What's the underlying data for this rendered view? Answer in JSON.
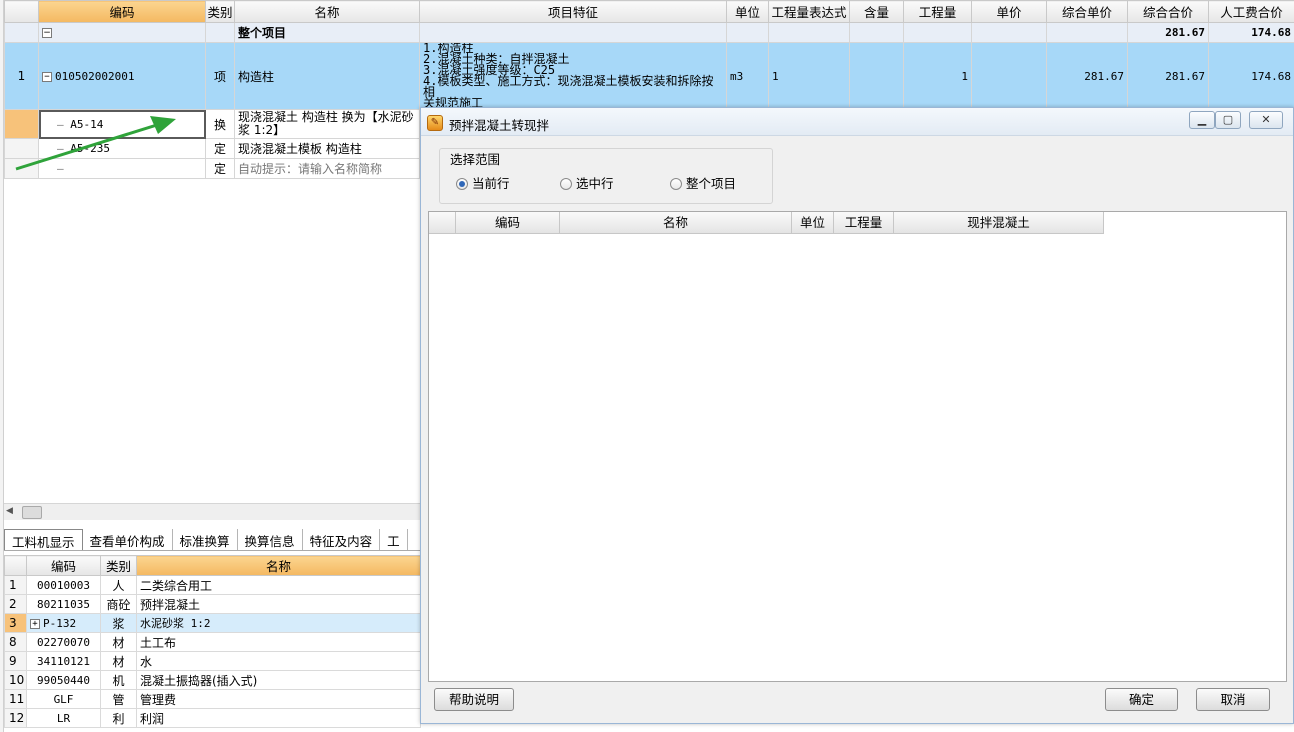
{
  "top_grid": {
    "headers": [
      "编码",
      "类别",
      "名称",
      "项目特征",
      "单位",
      "工程量表达式",
      "含量",
      "工程量",
      "单价",
      "综合单价",
      "综合合价",
      "人工费合价"
    ],
    "total_row": {
      "label": "整个项目",
      "total": "281.67",
      "labor": "174.68"
    },
    "item_row": {
      "num": "1",
      "code": "010502002001",
      "type": "项",
      "name": "构造柱",
      "features": [
        "1.构造柱",
        "2.混凝土种类：自拌混凝土",
        "3.混凝土强度等级：C25",
        "4.模板类型、施工方式：现浇混凝土模板安装和拆除按相",
        "关规范施工"
      ],
      "unit": "m3",
      "expr": "1",
      "qty": "1",
      "unit_price_total": "281.67",
      "total": "281.67",
      "labor": "174.68"
    },
    "sub_rows": [
      {
        "code": "A5-14",
        "type": "换",
        "name": "现浇混凝土 构造柱  换为【水泥砂浆 1:2】"
      },
      {
        "code": "A5-235",
        "type": "定",
        "name": "现浇混凝土模板 构造柱"
      },
      {
        "code": "",
        "type": "定",
        "name": "自动提示：请输入名称简称"
      }
    ]
  },
  "bottom_tabs": [
    "工料机显示",
    "查看单价构成",
    "标准换算",
    "换算信息",
    "特征及内容",
    "工"
  ],
  "bottom_grid": {
    "headers": [
      "编码",
      "类别",
      "名称"
    ],
    "rows": [
      {
        "num": "1",
        "code": "00010003",
        "type": "人",
        "name": "二类综合用工"
      },
      {
        "num": "2",
        "code": "80211035",
        "type": "商砼",
        "name": "预拌混凝土"
      },
      {
        "num": "3",
        "code": "P-132",
        "type": "浆",
        "name": "水泥砂浆 1:2"
      },
      {
        "num": "8",
        "code": "02270070",
        "type": "材",
        "name": "土工布"
      },
      {
        "num": "9",
        "code": "34110121",
        "type": "材",
        "name": "水"
      },
      {
        "num": "10",
        "code": "99050440",
        "type": "机",
        "name": "混凝土振捣器(插入式)"
      },
      {
        "num": "11",
        "code": "GLF",
        "type": "管",
        "name": "管理费"
      },
      {
        "num": "12",
        "code": "LR",
        "type": "利",
        "name": "利润"
      }
    ]
  },
  "dialog": {
    "title": "预拌混凝土转现拌",
    "range_label": "选择范围",
    "options": [
      "当前行",
      "选中行",
      "整个项目"
    ],
    "selected_option": "当前行",
    "list_headers": [
      "编码",
      "名称",
      "单位",
      "工程量",
      "现拌混凝土"
    ],
    "help_button": "帮助说明",
    "ok_button": "确定",
    "cancel_button": "取消"
  },
  "colors": {
    "accent_header": "#f4b861",
    "selected_row": "#a7d8f8",
    "arrow": "#2fa33a"
  }
}
